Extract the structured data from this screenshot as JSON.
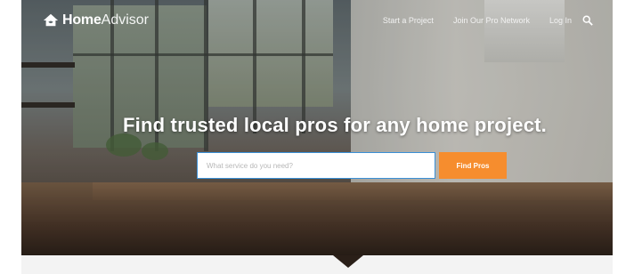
{
  "brand": {
    "name_bold": "Home",
    "name_light": "Advisor"
  },
  "nav": {
    "links": [
      "Start a Project",
      "Join Our Pro Network",
      "Log In"
    ],
    "search_icon": "search-icon"
  },
  "hero": {
    "headline": "Find trusted local pros for any home project.",
    "search_placeholder": "What service do you need?",
    "button_label": "Find Pros"
  },
  "colors": {
    "accent_button": "#f68d2e",
    "input_border": "#3a8fd6",
    "text_light": "#ffffff"
  }
}
